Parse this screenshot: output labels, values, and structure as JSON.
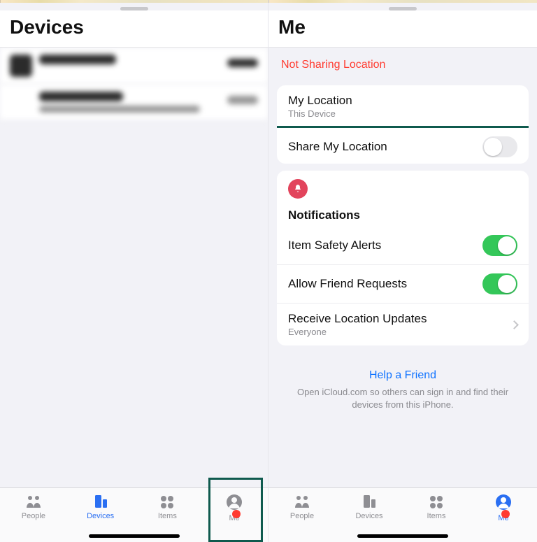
{
  "left": {
    "title": "Devices",
    "tabs": [
      "People",
      "Devices",
      "Items",
      "Me"
    ],
    "active_tab": 1,
    "me_badge": true
  },
  "right": {
    "title": "Me",
    "status": "Not Sharing Location",
    "my_location": {
      "title": "My Location",
      "sub": "This Device"
    },
    "share_row": {
      "title": "Share My Location",
      "on": false
    },
    "notif_header": "Notifications",
    "item_safety": {
      "title": "Item Safety Alerts",
      "on": true
    },
    "friend_req": {
      "title": "Allow Friend Requests",
      "on": true
    },
    "receive": {
      "title": "Receive Location Updates",
      "sub": "Everyone"
    },
    "help": {
      "link": "Help a Friend",
      "text": "Open iCloud.com so others can sign in and find their devices from this iPhone."
    },
    "tabs": [
      "People",
      "Devices",
      "Items",
      "Me"
    ],
    "active_tab": 3,
    "me_badge": true
  }
}
